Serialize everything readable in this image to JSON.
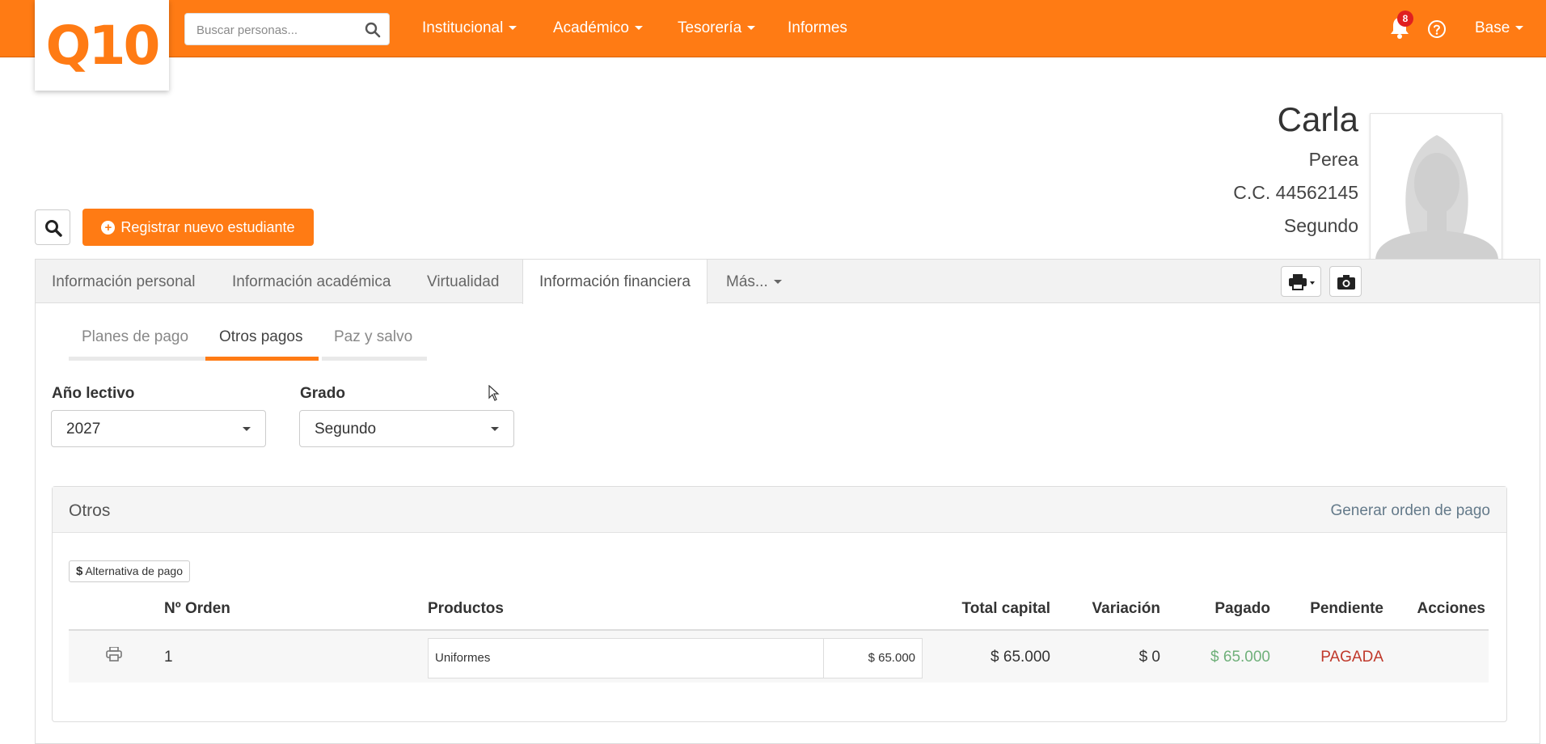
{
  "topbar": {
    "logo_text": "Q10",
    "search_placeholder": "Buscar personas...",
    "nav": [
      {
        "label": "Institucional"
      },
      {
        "label": "Académico"
      },
      {
        "label": "Tesorería"
      },
      {
        "label": "Informes"
      }
    ],
    "notifications_count": "8",
    "user_menu": "Base",
    "accent_color": "#ff7b14"
  },
  "profile": {
    "first_name": "Carla",
    "last_name": "Perea",
    "document": "C.C. 44562145",
    "grade": "Segundo"
  },
  "actions": {
    "register_label": "Registrar nuevo estudiante"
  },
  "tabs": [
    {
      "label": "Información personal"
    },
    {
      "label": "Información académica"
    },
    {
      "label": "Virtualidad"
    },
    {
      "label": "Información financiera"
    },
    {
      "label": "Más..."
    }
  ],
  "subtabs": [
    {
      "label": "Planes de pago"
    },
    {
      "label": "Otros pagos"
    },
    {
      "label": "Paz y salvo"
    }
  ],
  "filters": {
    "year_label": "Año lectivo",
    "year_value": "2027",
    "grade_label": "Grado",
    "grade_value": "Segundo"
  },
  "card": {
    "title": "Otros",
    "link": "Generar orden de pago",
    "alt_payment": "Alternativa de pago",
    "alt_payment_symbol": "$",
    "columns": [
      "Nº Orden",
      "Productos",
      "Total capital",
      "Variación",
      "Pagado",
      "Pendiente",
      "Acciones"
    ],
    "rows": [
      {
        "order": "1",
        "product": "Uniformes",
        "product_price": "$ 65.000",
        "total_capital": "$ 65.000",
        "variation": "$ 0",
        "paid": "$ 65.000",
        "pending": "PAGADA"
      }
    ],
    "paid_color": "#6fb07a",
    "pending_color": "#c0392b"
  }
}
